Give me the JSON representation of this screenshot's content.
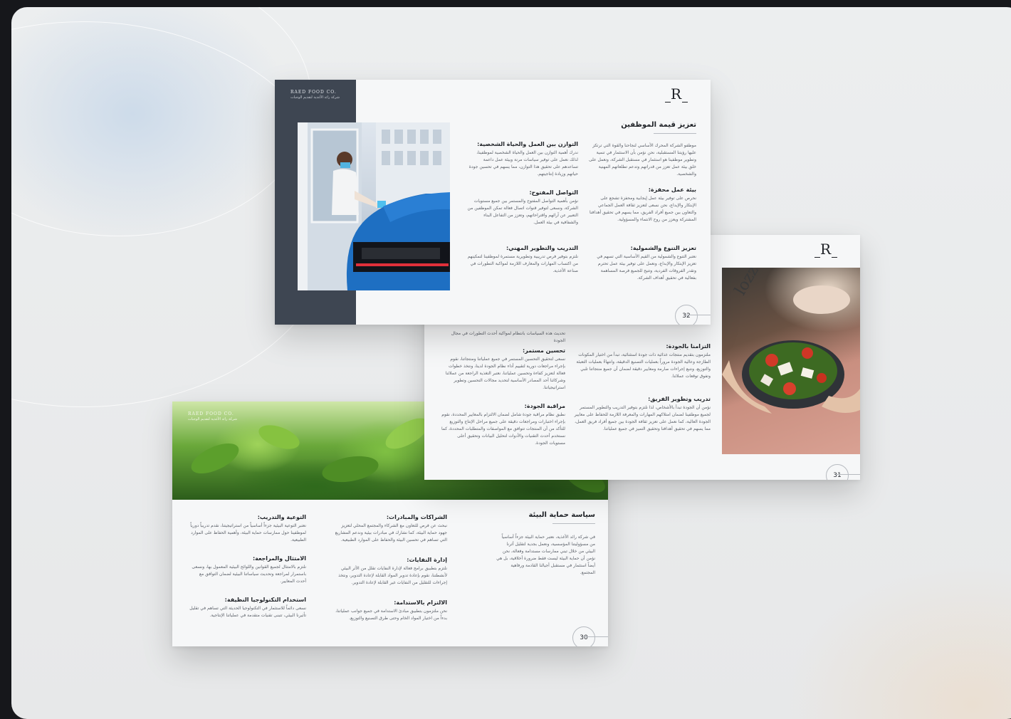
{
  "brand": {
    "name_en": "RAED FOOD CO.",
    "name_ar": "شركة رائد الأغذية لتقديم الوجبات",
    "logo_letter": "R"
  },
  "colors": {
    "dark_panel": "#3e4652",
    "car_blue": "#1e6fc2",
    "page_bg": "#f6f7f8"
  },
  "page32": {
    "page_number": "32",
    "image": "drive-through-service-photo",
    "title": "تعزيز قيمة الموظفين",
    "intro": "موظفو الشركة المحرك الأساسي لنجاحنا والقوة التي ترتكز عليها رؤيتنا المستقبلية، نحن نؤمن بأن الاستثمار في تنمية وتطوير موظفينا هو استثمار في مستقبل الشركة، ونعمل على خلق بيئة عمل تعزز من قدراتهم وتدعم تطلعاتهم المهنية والشخصية.",
    "right_sections": [
      {
        "heading": "بيئة عمل محفزة:",
        "body": "نحرص على توفير بيئة عمل إيجابية ومحفزة تشجع على الإبتكار والإبداع، نحن نسعى لتعزيز ثقافة العمل الجماعي والتعاون بين جميع أفراد الفريق، مما يسهم في تحقيق أهدافنا المشتركة ويعزز من روح الانتماء والمسؤولية."
      },
      {
        "heading": "تعزيز التنوع والشمولية:",
        "body": "نعتبر التنوع والشمولية من القيم الأساسية التي تسهم في تعزيز الإبتكار والإبداع، ونعمل على توفير بيئة عمل تحترم وتقدر الفروقات الفردية، وتتيح للجميع فرصة المساهمة بفعالية في تحقيق أهداف الشركة."
      }
    ],
    "left_sections": [
      {
        "heading": "التوازن بين العمل والحياة الشخصية:",
        "body": "ندرك أهمية التوازن بين العمل والحياة الشخصية لموظفينا، لذلك نعمل على توفير سياسات مرنة وبيئة عمل داعمة تساعدهم على تحقيق هذا التوازن، مما يسهم في تحسين جودة حياتهم وزيادة إنتاجيتهم."
      },
      {
        "heading": "التواصل المفتوح:",
        "body": "نؤمن بأهمية التواصل المفتوح والمستمر بين جميع مستويات الشركة، ونسعى لتوفير قنوات اتصال فعالة تمكن الموظفين من التعبير عن آرائهم واقتراحاتهم، وتعزز من التفاعل البناء والشفافية في بيئة العمل."
      },
      {
        "heading": "التدريب والتطوير المهني:",
        "body": "نلتزم بتوفير فرص تدريبية وتطويرية مستمرة لموظفينا لتمكينهم من اكتساب المهارات والمعارف اللازمة لمواكبة التطورات في صناعة الأغذية."
      }
    ]
  },
  "page31": {
    "page_number": "31",
    "image": "salad-bowl-photo",
    "top_line": "تحديث هذه السياسات بانتظام لمواكبة أحدث التطورات في مجال الجودة",
    "right_sections": [
      {
        "heading": "التزامنا بالجودة:",
        "body": "ملتزمون بتقديم منتجات غذائية ذات جودة استثنائية، تبدأ من اختيار المكونات الطازجة وعالية الجودة مروراً بعمليات التصنيع الدقيقة، وانتهاءً بعمليات التعبئة والتوزيع، ونتبع إجراءات صارمة ومعايير دقيقة لضمان أن جميع منتجاتنا تلبي وتفوق توقعات عملائنا."
      },
      {
        "heading": "تدريب وتطوير الفريق:",
        "body": "نؤمن أن الجودة تبدأ بالأشخاص، لذا نلتزم بتوفير التدريب والتطوير المستمر لجميع موظفينا لضمان امتلاكهم المهارات والمعرفة اللازمة للحفاظ على معايير الجودة العالية، كما نعمل على تعزيز ثقافة الجودة بين جميع أفراد فريق العمل، مما يسهم في تحقيق أهدافنا وتحقيق التميز في جميع عملياتنا."
      }
    ],
    "left_sections": [
      {
        "heading": "تحسين مستمر:",
        "body": "نسعى لتحقيق التحسين المستمر في جميع عملياتنا ومنتجاتنا، نقوم بإجراء مراجعات دورية لتقييم أداء نظام الجودة لدينا، ونتخذ خطوات فعالة لتعزيز كفاءة وتحسين عملياتنا، نعتبر التغذية الراجعة من عملائنا وشركائنا أحد المصادر الأساسية لتحديد مجالات التحسين وتطوير استراتيجياتنا."
      },
      {
        "heading": "مراقبة الجودة:",
        "body": "نطبق نظام مراقبة جودة شامل لضمان الالتزام بالمعايير المحددة، نقوم بإجراء اختبارات ومراجعات دقيقة على جميع مراحل الإنتاج والتوزيع للتأكد من أن المنتجات تتوافق مع المواصفات والمتطلبات المحددة، كما نستخدم أحدث التقنيات والأدوات لتحليل البيانات وتحقيق أعلى مستويات الجودة."
      }
    ]
  },
  "page30": {
    "page_number": "30",
    "image": "green-plants-photo",
    "title": "سياسة حماية البيئة",
    "intro": "في شركة رائد الأغذية، نعتبر حماية البيئة جزءاً أساسياً من مسؤوليتنا المؤسسية، ونعمل بجدية لتقليل أثرنا البيئي من خلال تبني ممارسات مستدامة وفعالة، نحن نؤمن أن حماية البيئة ليست فقط ضرورة أخلاقية، بل هي أيضاً استثمار في مستقبل أجيالنا القادمة ورفاهية المجتمع.",
    "middle_sections": [
      {
        "heading": "الشراكات والمبادرات:",
        "body": "نبحث عن فرص للتعاون مع الشركاء والمجتمع المحلي لتعزيز جهود حماية البيئة، كما نشارك في مبادرات بيئية وندعم المشاريع التي تساهم في تحسين البيئة والحفاظ على الموارد الطبيعية."
      },
      {
        "heading": "إدارة النفايات:",
        "body": "نلتزم بتطبيق برامج فعالة لإدارة النفايات تقلل من الأثر البيئي لأنشطتنا، نقوم بإعادة تدوير المواد القابلة لإعادة التدوير، ونتخذ إجراءات للتقليل من النفايات غير القابلة لإعادة التدوير."
      },
      {
        "heading": "الالتزام بالاستدامة:",
        "body": "نحن ملتزمون بتطبيق مبادئ الاستدامة في جميع جوانب عملياتنا، بدءاً من اختيار المواد الخام وحتى طرق التصنيع والتوزيع."
      }
    ],
    "left_sections": [
      {
        "heading": "التوعية والتدريب:",
        "body": "نعتبر التوعية البيئية جزءاً أساسياً من استراتيجيتنا، نقدم تدريباً دورياً لموظفينا حول ممارسات حماية البيئة، وأهمية الحفاظ على الموارد الطبيعية."
      },
      {
        "heading": "الامتثال والمراجعة:",
        "body": "نلتزم بالامتثال لجميع القوانين واللوائح البيئية المعمول بها، ونسعى باستمرار لمراجعة وتحديث سياساتنا البيئية لضمان التوافق مع أحدث المعايير."
      },
      {
        "heading": "استخدام التكنولوجيا النظيفة:",
        "body": "نسعى دائماً للاستثمار في التكنولوجيا الحديثة التي تساهم في تقليل تأثيرنا البيئي، تتبنى تقنيات متقدمة في عملياتنا الإنتاجية."
      }
    ]
  }
}
